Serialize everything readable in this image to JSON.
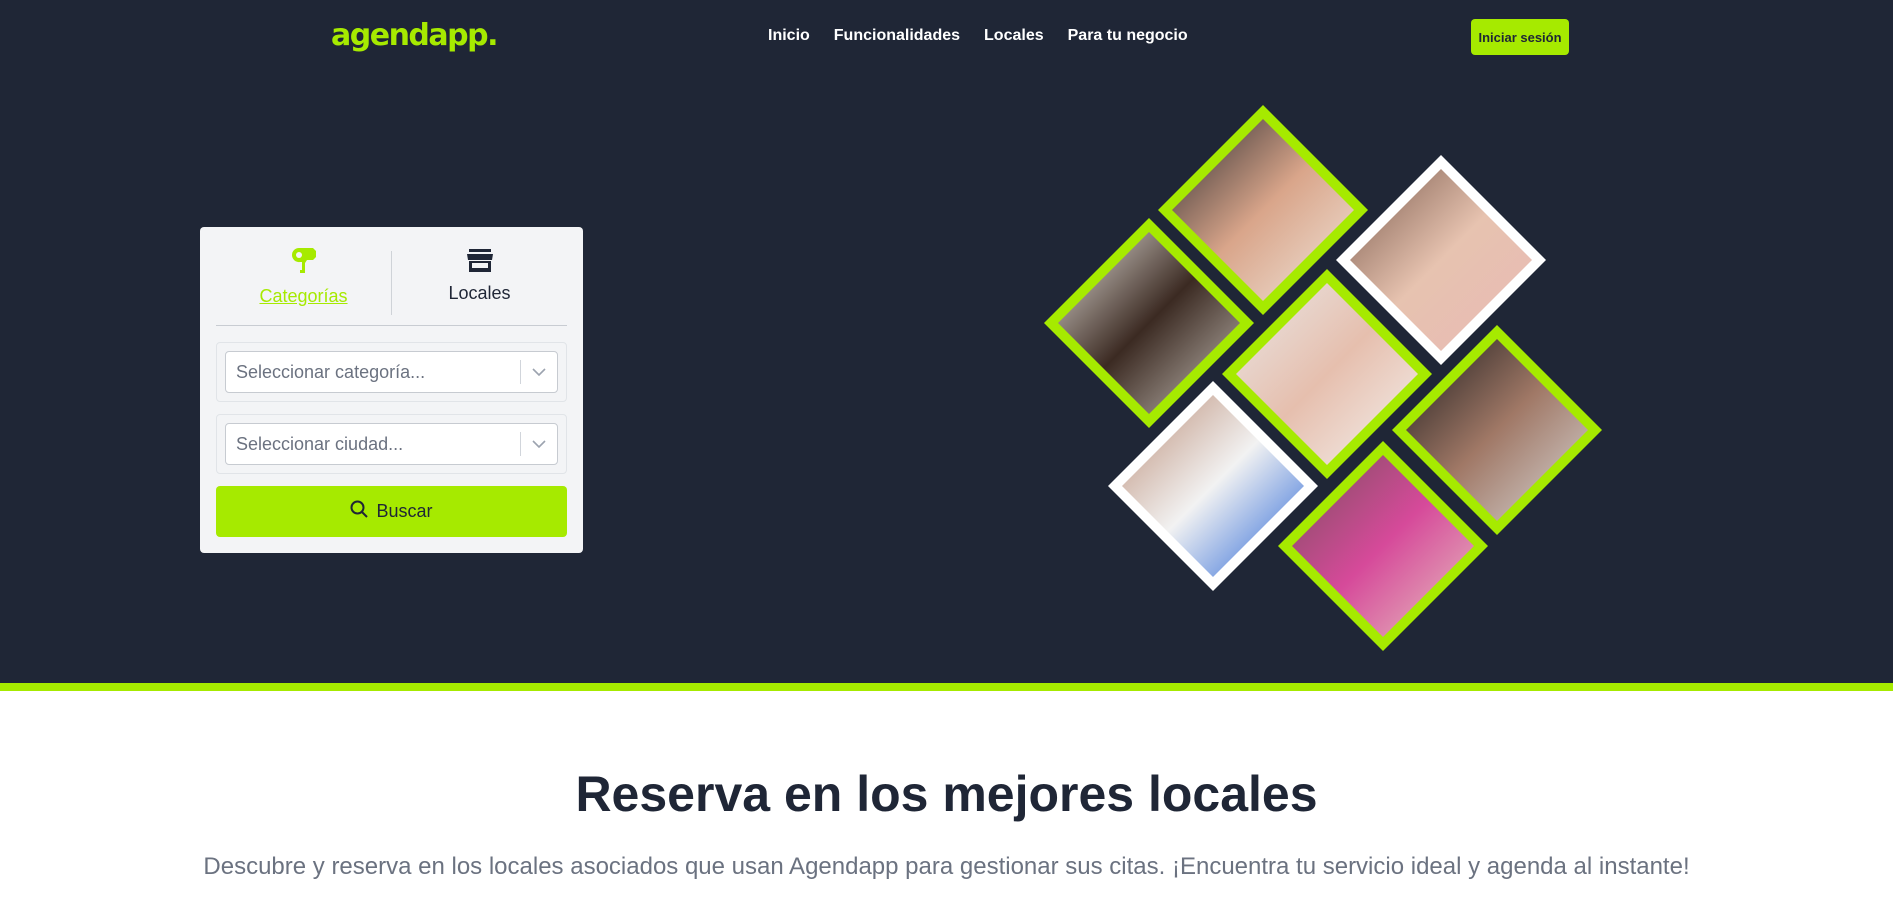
{
  "brand": {
    "logo_text": "agendapp.",
    "accent_color": "#a6ea00",
    "hero_bg": "#1f2636"
  },
  "nav": {
    "items": [
      "Inicio",
      "Funcionalidades",
      "Locales",
      "Para tu negocio"
    ]
  },
  "header": {
    "login_label": "Iniciar sesión"
  },
  "search_card": {
    "tabs": [
      {
        "label": "Categorías",
        "icon": "hair-dryer-icon",
        "active": true
      },
      {
        "label": "Locales",
        "icon": "store-icon",
        "active": false
      }
    ],
    "category_placeholder": "Seleccionar categoría...",
    "city_placeholder": "Seleccionar ciudad...",
    "search_label": "Buscar"
  },
  "collage": {
    "tiles": [
      {
        "subject": "laser-treatment-photo",
        "frame": "green"
      },
      {
        "subject": "hair-salon-photo",
        "frame": "green"
      },
      {
        "subject": "facial-treatment-photo",
        "frame": "green"
      },
      {
        "subject": "makeup-portrait-photo",
        "frame": "white"
      },
      {
        "subject": "dental-care-photo",
        "frame": "white"
      },
      {
        "subject": "barber-photo",
        "frame": "green"
      },
      {
        "subject": "manicure-photo",
        "frame": "green"
      }
    ]
  },
  "section": {
    "title": "Reserva en los mejores locales",
    "description": "Descubre y reserva en los locales asociados que usan Agendapp para gestionar sus citas. ¡Encuentra tu servicio ideal y agenda al instante!"
  }
}
